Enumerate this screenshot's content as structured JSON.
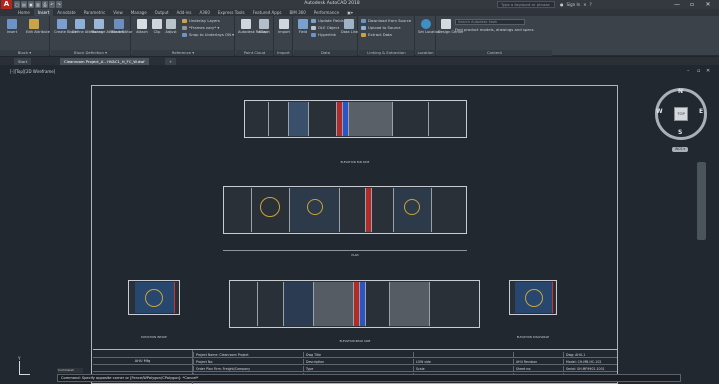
{
  "app": {
    "title": "Autodesk AutoCAD 2018",
    "logo": "A",
    "search_placeholder": "Type a keyword or phrase",
    "signin_label": "Sign In",
    "quick_access": [
      "new-icon",
      "open-icon",
      "save-icon",
      "saveas-icon",
      "print-icon",
      "undo-icon",
      "redo-icon"
    ],
    "title_tools": [
      "Sign In",
      "?"
    ],
    "window_controls": [
      "—",
      "▫",
      "✕"
    ]
  },
  "ribbon": {
    "tabs": [
      {
        "label": "Home"
      },
      {
        "label": "Insert",
        "active": true
      },
      {
        "label": "Annotate"
      },
      {
        "label": "Parametric"
      },
      {
        "label": "View"
      },
      {
        "label": "Manage"
      },
      {
        "label": "Output"
      },
      {
        "label": "Add-ins"
      },
      {
        "label": "A360"
      },
      {
        "label": "Express Tools"
      },
      {
        "label": "Featured Apps"
      },
      {
        "label": "BIM 360"
      },
      {
        "label": "Performance"
      },
      {
        "label": "▣▾"
      }
    ],
    "block_panel": {
      "label": "Block ▾",
      "insert": "Insert",
      "edit_attribute": "Edit Attribute"
    },
    "block_definition_panel": {
      "label": "Block Definition ▾",
      "buttons": [
        "Create Block",
        "Define Attributes",
        "Manage Attributes",
        "Block Editor"
      ]
    },
    "reference_panel": {
      "label": "Reference ▾",
      "buttons": [
        "Attach",
        "Clip",
        "Adjust"
      ],
      "rows": [
        "Underlay Layers",
        "*Frames vary* ▾",
        "Snap to Underlays ON ▾"
      ]
    },
    "pointcloud_panel": {
      "label": "Point Cloud",
      "buttons": [
        "Autodesk ReCap",
        "Attach"
      ]
    },
    "import_panel": {
      "label": "Import",
      "button": "Import"
    },
    "data_panel": {
      "label": "Data",
      "field": "Field",
      "rows": [
        "Update Fields",
        "OLE Object",
        "Hyperlink"
      ],
      "data_link": "Data Link"
    },
    "linking_panel": {
      "label": "Linking & Extraction",
      "rows": [
        "Download from Source",
        "Upload to Source",
        "Extract Data"
      ]
    },
    "location_panel": {
      "label": "Location",
      "button": "Set Location"
    },
    "content_panel": {
      "label": "Content",
      "button": "Design Center",
      "search_placeholder": "Search Autodesk Seek",
      "description": "Find product models, drawings and specs"
    }
  },
  "file_tabs": [
    {
      "label": "Start",
      "active": false
    },
    {
      "label": "Cleanroom Project_A - HVAC1_H_FC_W.dwf",
      "active": true
    },
    {
      "label": "+",
      "active": false
    }
  ],
  "viewport": {
    "label": "[-][Top][2D Wireframe]",
    "controls": [
      "–",
      "▫",
      "✕"
    ]
  },
  "drawing": {
    "captions": {
      "top_view": "ELEVATION FAN SIDE",
      "plan_view": "PLAN",
      "left_view": "ELEVATION INTAKE",
      "front_view": "ELEVATION REAR SIDE",
      "right_view": "ELEVATION DISCHARGE"
    }
  },
  "title_block": {
    "company": "AHU Mfg",
    "rows": [
      [
        "Project Name: Cleanroom Project",
        "Dwg Title",
        "",
        "",
        "Dwg: AHU-1"
      ],
      [
        "Project No:",
        "Description",
        "LOW side",
        "AHU Revision",
        "Model: CH-MB-HC-102"
      ],
      [
        "Order Plan Firm: Freight/Company",
        "Type",
        "Scale",
        "Sheet no:",
        "Serial: SH-MF9902-1001"
      ],
      [
        "Draw 4: Xxxxxxx",
        "Dwg No:",
        "Dimension: 1:0",
        "Checked by:",
        "Date: 28.09.2021_10:37:00"
      ]
    ]
  },
  "viewcube": {
    "top": "TOP",
    "n": "N",
    "s": "S",
    "e": "E",
    "w": "W",
    "wcs": "WCS ▾"
  },
  "command": {
    "history_label": "Command:",
    "line": "Command: Specify opposite corner or [Fence/WPolygon/CPolygon]: *Cancel*"
  },
  "ucs": {
    "y": "Y"
  }
}
